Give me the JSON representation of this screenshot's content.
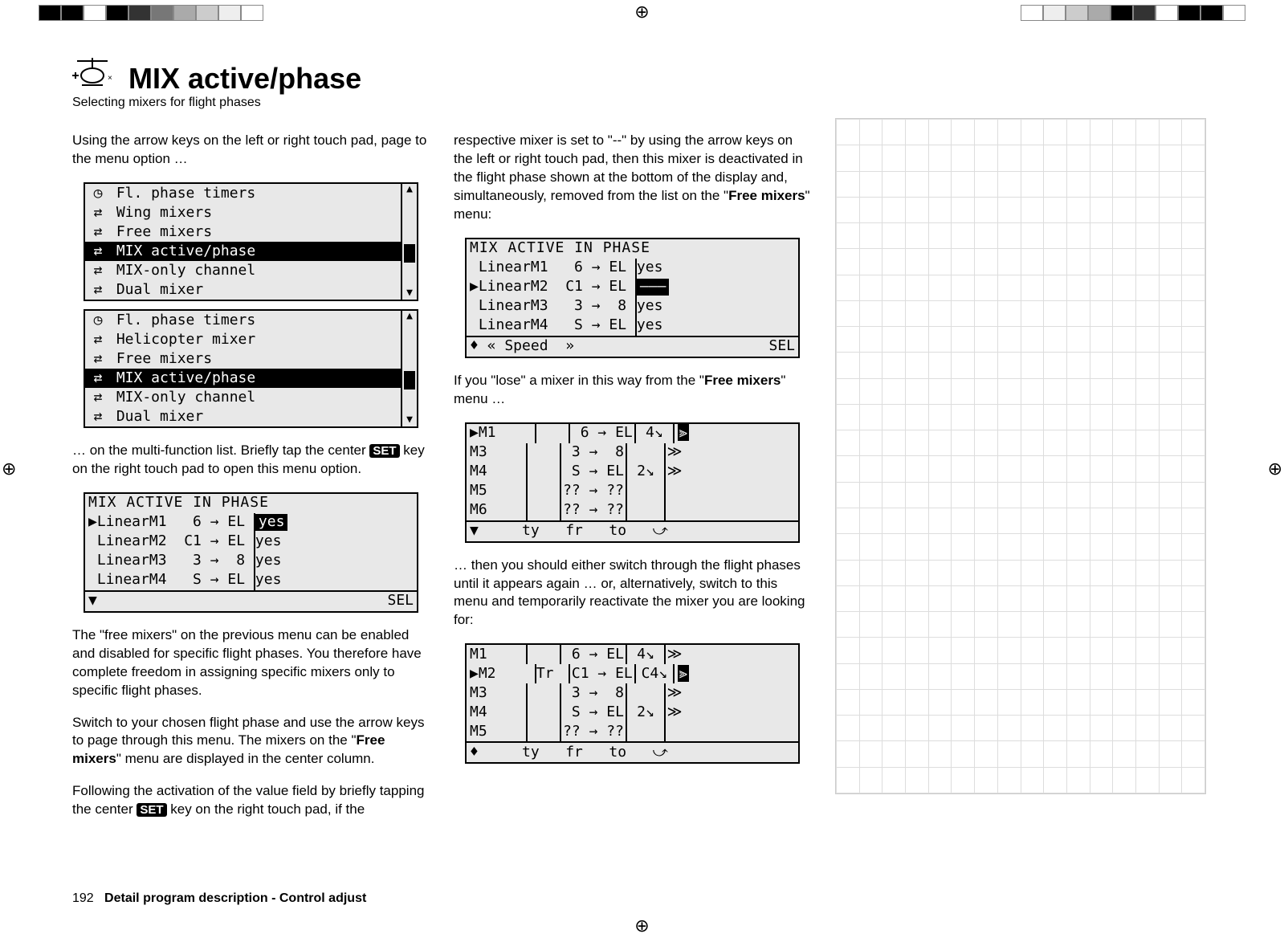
{
  "header": {
    "title": "MIX active/phase",
    "subtitle": "Selecting mixers for flight phases"
  },
  "col1": {
    "p1": "Using the arrow keys on the left or right touch pad, page to the menu option …",
    "menu1": {
      "items": [
        "Fl. phase timers",
        "Wing mixers",
        "Free mixers",
        "MIX active/phase",
        "MIX-only channel",
        "Dual mixer"
      ],
      "selected": 3
    },
    "menu2": {
      "items": [
        "Fl. phase timers",
        "Helicopter mixer",
        "Free mixers",
        "MIX active/phase",
        "MIX-only channel",
        "Dual mixer"
      ],
      "selected": 3
    },
    "p2a": "… on the multi-function list. Briefly tap the center ",
    "p2b": " key on the right touch pad to open this menu option.",
    "set": "SET",
    "lcd3": {
      "title": "MIX ACTIVE IN PHASE",
      "rows": [
        {
          "cursor": "▶",
          "name": "LinearM1",
          "mix": " 6 → EL",
          "val": "yes",
          "hl": true
        },
        {
          "cursor": " ",
          "name": "LinearM2",
          "mix": "C1 → EL",
          "val": "yes"
        },
        {
          "cursor": " ",
          "name": "LinearM3",
          "mix": " 3 →  8",
          "val": "yes"
        },
        {
          "cursor": " ",
          "name": "LinearM4",
          "mix": " S → EL",
          "val": "yes"
        }
      ],
      "footer_l": "▼",
      "footer_r": "SEL"
    },
    "p3": "The \"free mixers\" on the previous menu can be enabled and disabled for specific flight phases. You therefore have complete freedom in assigning specific mixers only to specific flight phases.",
    "p4a": "Switch to your chosen flight phase and use the arrow keys to page through this menu. The mixers on the \"",
    "p4bold": "Free mixers",
    "p4b": "\" menu are displayed in the center column.",
    "p5a": "Following the activation of the value field by briefly tapping the center ",
    "p5b": " key on the right touch pad, if the"
  },
  "col2": {
    "p1a": "respective mixer is set to \"--\" by using the arrow keys on the left or right touch pad, then this mixer is deactivated in the flight phase shown at the bottom of the display and, simultaneously, removed from the list on the \"",
    "p1bold": "Free mixers",
    "p1b": "\" menu:",
    "lcd1": {
      "title": "MIX ACTIVE IN PHASE",
      "rows": [
        {
          "cursor": " ",
          "name": "LinearM1",
          "mix": " 6 → EL",
          "val": "yes"
        },
        {
          "cursor": "▶",
          "name": "LinearM2",
          "mix": "C1 → EL",
          "val": "–––",
          "hl": true
        },
        {
          "cursor": " ",
          "name": "LinearM3",
          "mix": " 3 →  8",
          "val": "yes"
        },
        {
          "cursor": " ",
          "name": "LinearM4",
          "mix": " S → EL",
          "val": "yes"
        }
      ],
      "footer_l": "♦ « Speed  »",
      "footer_r": "SEL"
    },
    "p2a": "If you \"lose\" a mixer in this way from the \"",
    "p2bold": "Free mixers",
    "p2b": "\" menu …",
    "lcd2": {
      "rows": [
        {
          "cursor": "▶",
          "c1": "M1",
          "c2": "",
          "c3": " 6 → EL",
          "c4": "4↘",
          "c5": "⫸",
          "hlc5": true
        },
        {
          "cursor": " ",
          "c1": "M3",
          "c2": "",
          "c3": " 3 →  8",
          "c4": "",
          "c5": "≫"
        },
        {
          "cursor": " ",
          "c1": "M4",
          "c2": "",
          "c3": " S → EL",
          "c4": "2↘",
          "c5": "≫"
        },
        {
          "cursor": " ",
          "c1": "M5",
          "c2": "",
          "c3": "?? → ??",
          "c4": "",
          "c5": ""
        },
        {
          "cursor": " ",
          "c1": "M6",
          "c2": "",
          "c3": "?? → ??",
          "c4": "",
          "c5": ""
        }
      ],
      "footer": "▼     ty   fr   to   ⤻"
    },
    "p3": "… then you should either switch through the flight phases until it appears again … or, alternatively, switch to this menu and temporarily reactivate the mixer you are looking for:",
    "lcd3": {
      "rows": [
        {
          "cursor": " ",
          "c1": "M1",
          "c2": "",
          "c3": " 6 → EL",
          "c4": "4↘",
          "c5": "≫"
        },
        {
          "cursor": "▶",
          "c1": "M2",
          "c2": "Tr",
          "c3": "C1 → EL",
          "c4": "C4↘",
          "c5": "⫸",
          "hlc5": true
        },
        {
          "cursor": " ",
          "c1": "M3",
          "c2": "",
          "c3": " 3 →  8",
          "c4": "",
          "c5": "≫"
        },
        {
          "cursor": " ",
          "c1": "M4",
          "c2": "",
          "c3": " S → EL",
          "c4": "2↘",
          "c5": "≫"
        },
        {
          "cursor": " ",
          "c1": "M5",
          "c2": "",
          "c3": "?? → ??",
          "c4": "",
          "c5": ""
        }
      ],
      "footer": "♦     ty   fr   to   ⤻"
    }
  },
  "footer": {
    "pagenum": "192",
    "text": "Detail program description - Control adjust"
  },
  "colorbar_left": [
    "#000",
    "#000",
    "#fff",
    "#000",
    "#333",
    "#777",
    "#aaa",
    "#ccc",
    "#eee",
    "#fff"
  ],
  "colorbar_right": [
    "#fff",
    "#eee",
    "#ccc",
    "#aaa",
    "#000",
    "#333",
    "#fff",
    "#000",
    "#000",
    "#fff"
  ]
}
